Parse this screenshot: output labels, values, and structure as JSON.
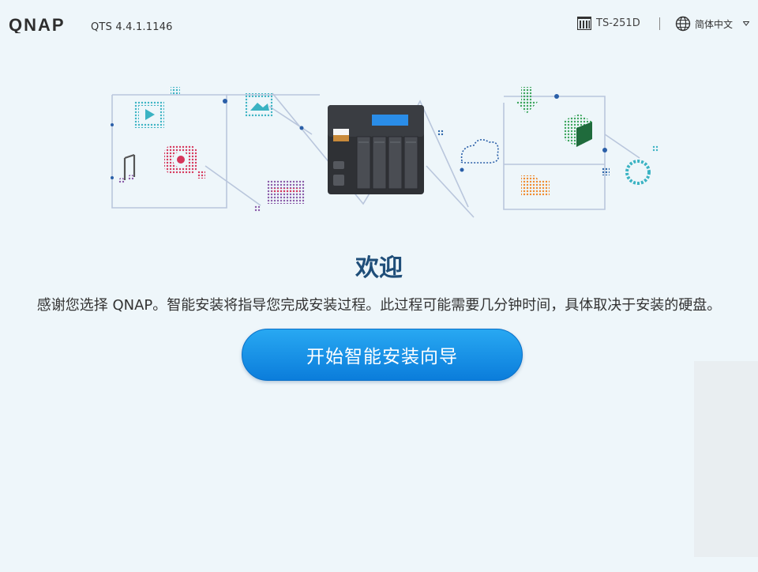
{
  "header": {
    "version": "QTS 4.4.1.1146",
    "model": "TS-251D",
    "language": "简体中文"
  },
  "icons": {
    "logo": "qnap-logo",
    "model": "nas-device-icon",
    "language": "globe-icon",
    "dropdown": "caret-down-icon"
  },
  "welcome": {
    "title": "欢迎",
    "description": "感谢您选择 QNAP。智能安装将指导您完成安装过程。此过程可能需要几分钟时间，具体取决于安装的硬盘。",
    "start_button": "开始智能安装向导"
  },
  "colors": {
    "background": "#eef6fa",
    "title": "#1f4e79",
    "button": "#1a93e8"
  }
}
